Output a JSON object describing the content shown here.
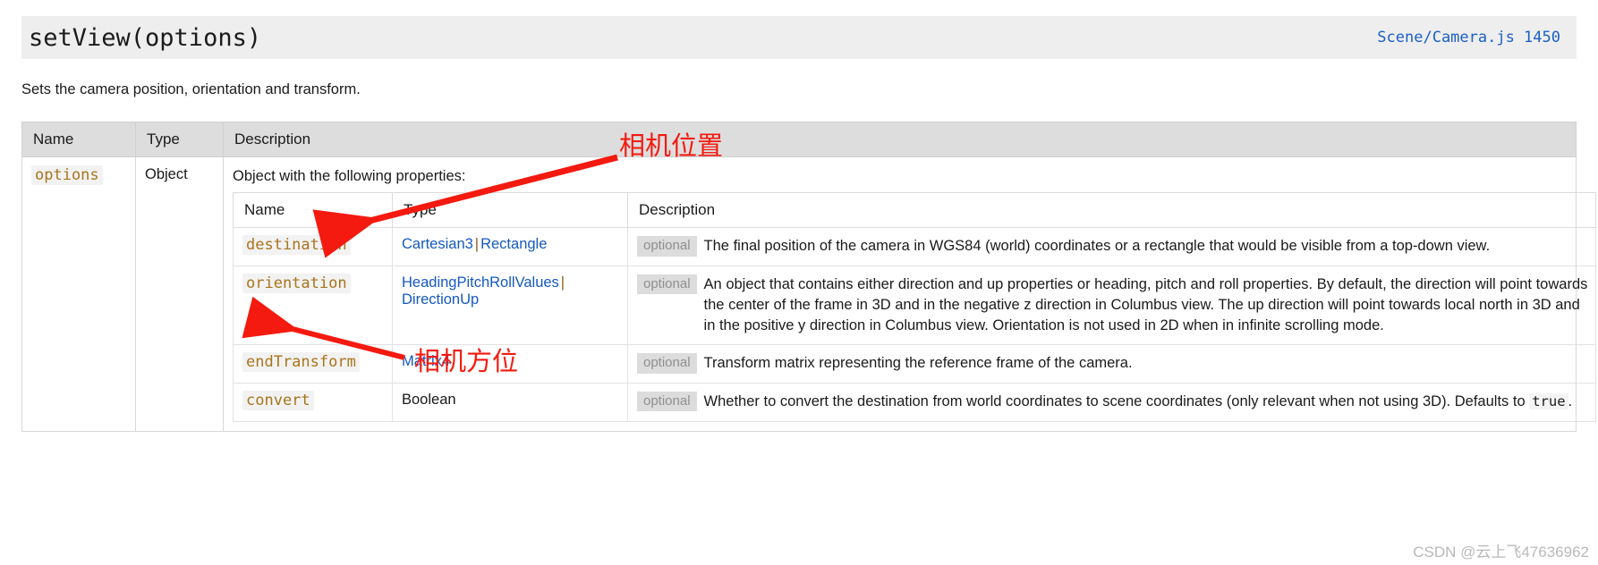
{
  "header": {
    "signature": "setView(options)",
    "source_link": "Scene/Camera.js 1450",
    "source_link_color": "#1a5fc8"
  },
  "intro": "Sets the camera position, orientation and transform.",
  "outer_table": {
    "columns": [
      "Name",
      "Type",
      "Description"
    ],
    "row": {
      "name": "options",
      "type": "Object",
      "description_lead": "Object with the following properties:"
    }
  },
  "inner_table": {
    "columns": [
      "Name",
      "Type",
      "Description"
    ],
    "rows": [
      {
        "name": "destination",
        "types": [
          "Cartesian3",
          "Rectangle"
        ],
        "type_separator": "|",
        "badge": "optional",
        "description": "The final position of the camera in WGS84 (world) coordinates or a rectangle that would be visible from a top-down view."
      },
      {
        "name": "orientation",
        "types": [
          "HeadingPitchRollValues",
          "DirectionUp"
        ],
        "type_separator": "|",
        "badge": "optional",
        "description": "An object that contains either direction and up properties or heading, pitch and roll properties. By default, the direction will point towards the center of the frame in 3D and in the negative z direction in Columbus view. The up direction will point towards local north in 3D and in the positive y direction in Columbus view. Orientation is not used in 2D when in infinite scrolling mode."
      },
      {
        "name": "endTransform",
        "types": [
          "Matrix4"
        ],
        "type_separator": "",
        "badge": "optional",
        "description": "Transform matrix representing the reference frame of the camera."
      },
      {
        "name": "convert",
        "types": [],
        "type_plain": "Boolean",
        "type_separator": "",
        "badge": "optional",
        "description_before": "Whether to convert the destination from world coordinates to scene coordinates (only relevant when not using 3D). Defaults to",
        "description_code": "true",
        "description_after": "."
      }
    ]
  },
  "annotations": [
    {
      "id": "camera-position",
      "text": "相机位置",
      "color": "#f41a0f"
    },
    {
      "id": "camera-orientation",
      "text": "相机方位",
      "color": "#f41a0f"
    }
  ],
  "watermark": "CSDN @云上飞47636962"
}
